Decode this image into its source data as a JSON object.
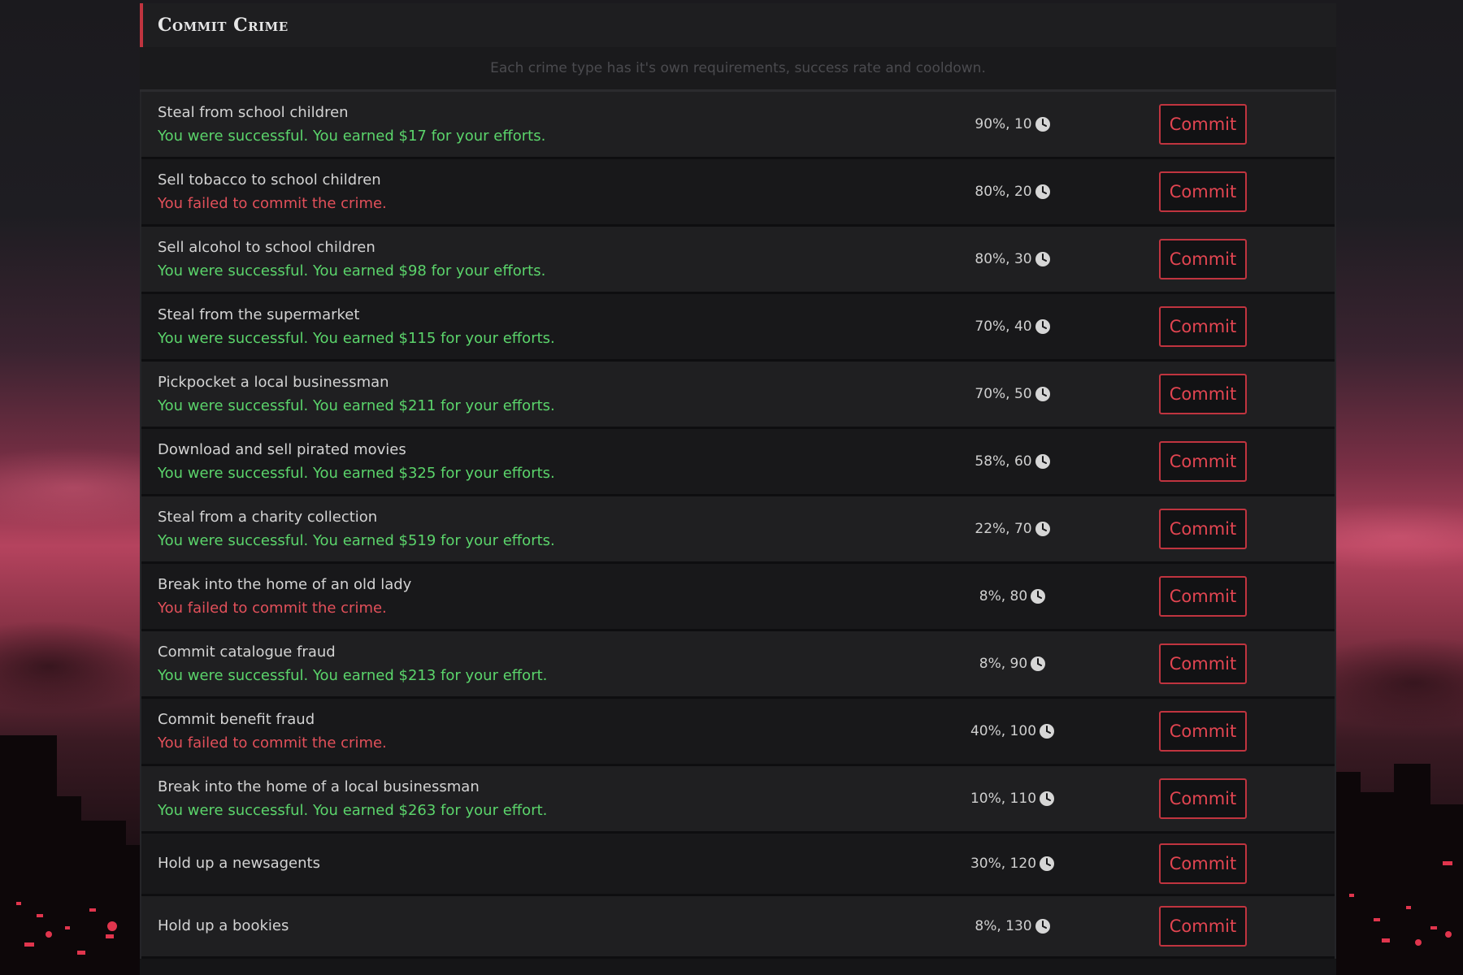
{
  "panel": {
    "title": "Commit Crime",
    "subtitle": "Each crime type has it's own requirements, success rate and cooldown."
  },
  "crimes": [
    {
      "name": "Steal from school children",
      "result": "You were successful. You earned $17 for your efforts.",
      "status": "success",
      "stats": "90%, 10",
      "button": "Commit"
    },
    {
      "name": "Sell tobacco to school children",
      "result": "You failed to commit the crime.",
      "status": "fail",
      "stats": "80%, 20",
      "button": "Commit"
    },
    {
      "name": "Sell alcohol to school children",
      "result": "You were successful. You earned $98 for your efforts.",
      "status": "success",
      "stats": "80%, 30",
      "button": "Commit"
    },
    {
      "name": "Steal from the supermarket",
      "result": "You were successful. You earned $115 for your efforts.",
      "status": "success",
      "stats": "70%, 40",
      "button": "Commit"
    },
    {
      "name": "Pickpocket a local businessman",
      "result": "You were successful. You earned $211 for your efforts.",
      "status": "success",
      "stats": "70%, 50",
      "button": "Commit"
    },
    {
      "name": "Download and sell pirated movies",
      "result": "You were successful. You earned $325 for your efforts.",
      "status": "success",
      "stats": "58%, 60",
      "button": "Commit"
    },
    {
      "name": "Steal from a charity collection",
      "result": "You were successful. You earned $519 for your efforts.",
      "status": "success",
      "stats": "22%, 70",
      "button": "Commit"
    },
    {
      "name": "Break into the home of an old lady",
      "result": "You failed to commit the crime.",
      "status": "fail",
      "stats": "8%, 80",
      "button": "Commit"
    },
    {
      "name": "Commit catalogue fraud",
      "result": "You were successful. You earned $213 for your effort.",
      "status": "success",
      "stats": "8%, 90",
      "button": "Commit"
    },
    {
      "name": "Commit benefit fraud",
      "result": "You failed to commit the crime.",
      "status": "fail",
      "stats": "40%, 100",
      "button": "Commit"
    },
    {
      "name": "Break into the home of a local businessman",
      "result": "You were successful. You earned $263 for your effort.",
      "status": "success",
      "stats": "10%, 110",
      "button": "Commit"
    },
    {
      "name": "Hold up a newsagents",
      "result": "",
      "status": "none",
      "stats": "30%, 120",
      "button": "Commit"
    },
    {
      "name": "Hold up a bookies",
      "result": "",
      "status": "none",
      "stats": "8%, 130",
      "button": "Commit"
    }
  ],
  "colors": {
    "accent": "#c0343f",
    "success": "#5bd46b",
    "fail": "#e2505a"
  },
  "icons": {
    "cooldown": "clock-icon"
  }
}
